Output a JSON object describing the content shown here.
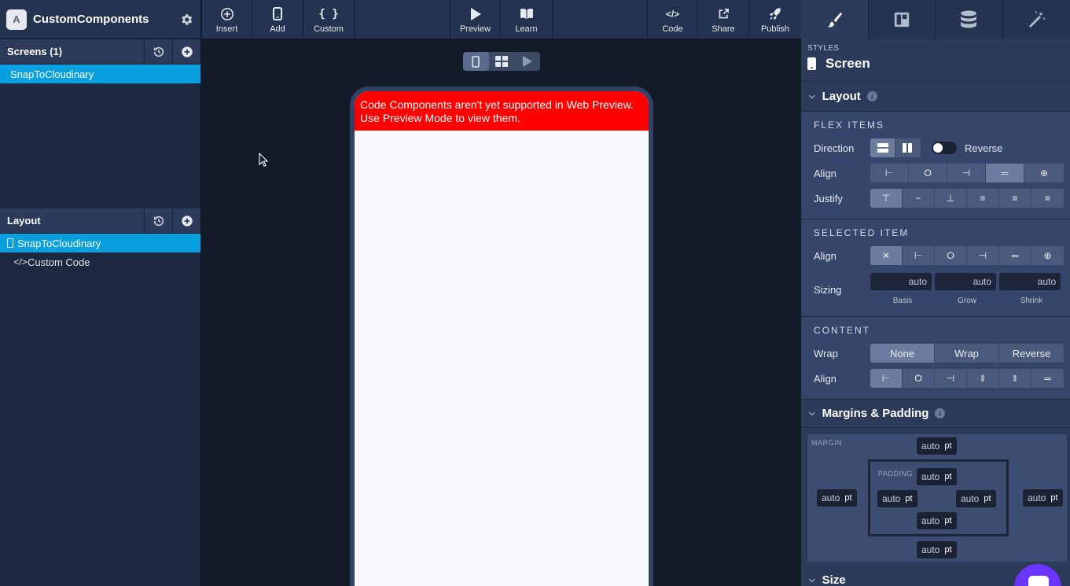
{
  "app": {
    "title": "CustomComponents",
    "logo_letter": "A"
  },
  "screens": {
    "header": "Screens (1)",
    "items": [
      "SnapToCloudinary"
    ]
  },
  "layout": {
    "header": "Layout",
    "items": [
      {
        "label": "SnapToCloudinary"
      },
      {
        "label": "Custom Code"
      }
    ]
  },
  "toolbar": {
    "insert": "Insert",
    "add": "Add",
    "custom": "Custom",
    "preview": "Preview",
    "learn": "Learn",
    "code": "Code",
    "share": "Share",
    "publish": "Publish"
  },
  "canvas": {
    "warning": "Code Components aren't yet supported in Web Preview. Use Preview Mode to view them."
  },
  "panel": {
    "styles_caption": "STYLES",
    "screen_title": "Screen",
    "layout_section": "Layout",
    "flex_items_caption": "FLEX ITEMS",
    "direction_label": "Direction",
    "reverse_label": "Reverse",
    "align_label": "Align",
    "justify_label": "Justify",
    "selected_item_caption": "SELECTED ITEM",
    "selected_align_label": "Align",
    "sizing_label": "Sizing",
    "sizing": [
      {
        "value": "auto",
        "caption": "Basis"
      },
      {
        "value": "auto",
        "caption": "Grow"
      },
      {
        "value": "auto",
        "caption": "Shrink"
      }
    ],
    "content_caption": "CONTENT",
    "wrap_label": "Wrap",
    "wrap_options": [
      "None",
      "Wrap",
      "Reverse"
    ],
    "content_align_label": "Align",
    "margins_section": "Margins & Padding",
    "margin_caption": "MARGIN",
    "padding_caption": "PADDING",
    "value": "auto",
    "unit": "pt",
    "size_section": "Size"
  },
  "colors": {
    "accent": "#0aa0e0",
    "warning_bg": "#ff0000",
    "chat": "#6a35ff"
  }
}
